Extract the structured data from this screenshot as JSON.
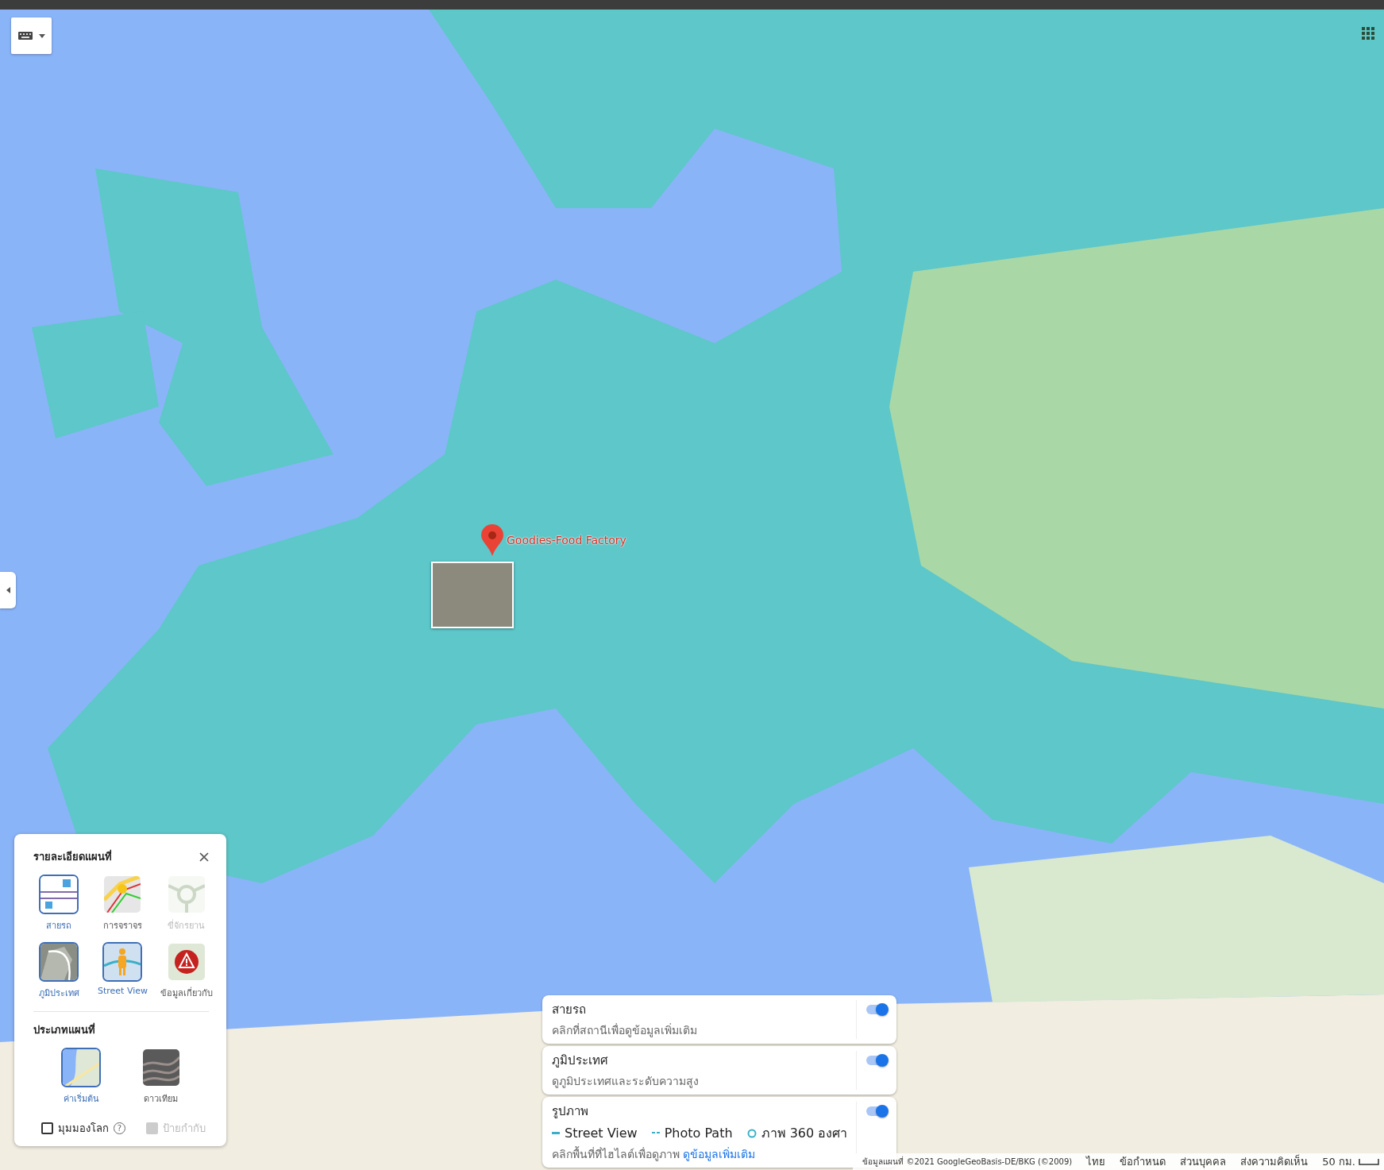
{
  "pin": {
    "label": "Goodies-Food Factory"
  },
  "details_panel": {
    "title": "รายละเอียดแผนที่",
    "details": [
      {
        "kind": "transit",
        "label": "สายรถ",
        "selected": true,
        "disabled": false
      },
      {
        "kind": "traffic",
        "label": "การจราจร",
        "selected": false,
        "disabled": false
      },
      {
        "kind": "bicycle",
        "label": "ขี่จักรยาน",
        "selected": false,
        "disabled": true
      },
      {
        "kind": "terrain",
        "label": "ภูมิประเทศ",
        "selected": true,
        "disabled": false
      },
      {
        "kind": "streetview",
        "label": "Street View",
        "selected": true,
        "disabled": false
      },
      {
        "kind": "info",
        "label": "ข้อมูลเกี่ยวกับ",
        "selected": false,
        "disabled": false
      }
    ],
    "map_type_title": "ประเภทแผนที่",
    "map_types": [
      {
        "kind": "default",
        "label": "ค่าเริ่มต้น",
        "selected": true
      },
      {
        "kind": "satellite",
        "label": "ดาวเทียม",
        "selected": false
      }
    ],
    "globe_view": {
      "label": "มุมมองโลก",
      "checked": false,
      "help": "?"
    },
    "labels": {
      "label": "ป้ายกำกับ",
      "checked": true,
      "disabled": true
    }
  },
  "layer_cards": [
    {
      "title": "สายรถ",
      "description": "คลิกที่สถานีเพื่อดูข้อมูลเพิ่มเติม",
      "on": true
    },
    {
      "title": "ภูมิประเทศ",
      "description": "ดูภูมิประเทศและระดับความสูง",
      "on": true
    },
    {
      "title": "รูปภาพ",
      "legend": [
        {
          "kind": "line",
          "label": "Street View"
        },
        {
          "kind": "dashed",
          "label": "Photo Path"
        },
        {
          "kind": "circle",
          "label": "ภาพ 360 องศา"
        }
      ],
      "description": "คลิกพื้นที่ที่ไฮไลต์เพื่อดูภาพ",
      "link": "ดูข้อมูลเพิ่มเติม",
      "on": true
    }
  ],
  "footer": {
    "attribution": "ข้อมูลแผนที่ ©2021 GoogleGeoBasis-DE/BKG (©2009)",
    "links": [
      "ไทย",
      "ข้อกำหนด",
      "ส่วนบุคคล",
      "ส่งความคิดเห็น"
    ],
    "scale": "50 กม."
  }
}
